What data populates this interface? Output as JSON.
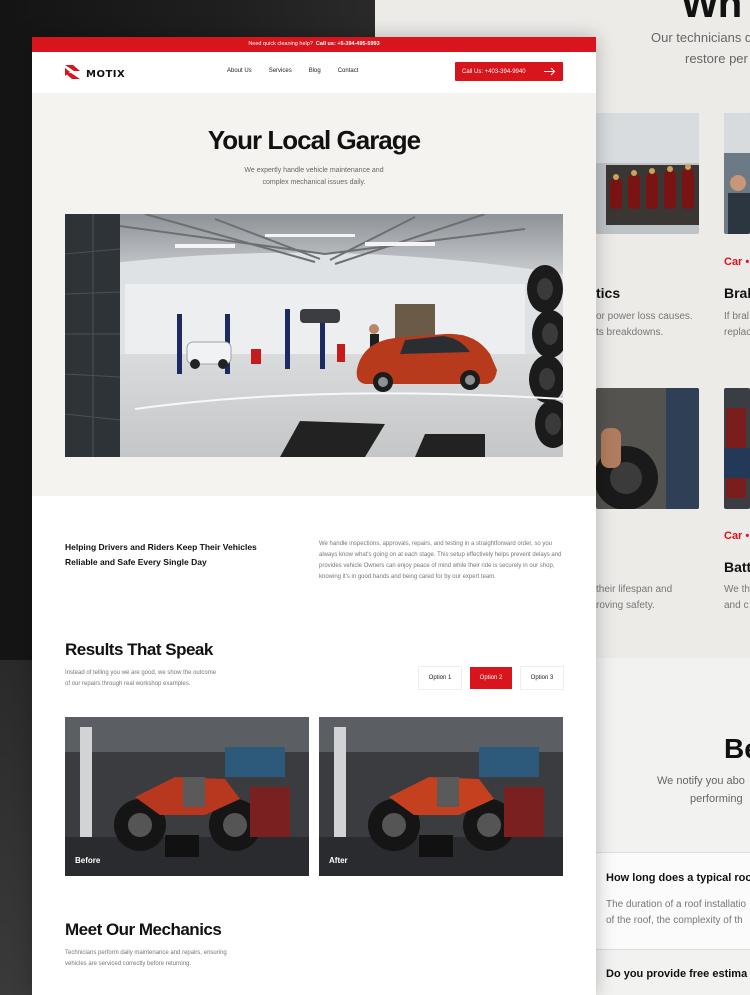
{
  "topbar": {
    "prompt": "Need quick cleaning help?",
    "phone": "Call us: +5-394-495-5993"
  },
  "nav": {
    "logo_text": "MOTIX",
    "links": [
      "About Us",
      "Services",
      "Blog",
      "Contact"
    ],
    "cta": "Call Us: +403-394-9940"
  },
  "hero": {
    "title": "Your Local Garage",
    "subtitle_line1": "We expertly handle vehicle maintenance and",
    "subtitle_line2": "complex mechanical issues daily."
  },
  "about": {
    "heading_line1": "Helping Drivers and Riders Keep Their Vehicles",
    "heading_line2": "Reliable and Safe Every Single Day",
    "body": "We handle inspections, approvals, repairs, and testing in a straightforward order, so you always know what's going on at each stage. This setup effectively helps prevent delays and provides vehicle Owners can enjoy peace of mind while their ride is securely in our shop, knowing it's in good hands and being cared for by our expert team."
  },
  "results": {
    "title": "Results That Speak",
    "body_line1": "Instead of telling you we are good, we show the outcome",
    "body_line2": "of our repairs through real workshop examples.",
    "options": [
      "Option 1",
      "Option 2",
      "Option 3"
    ],
    "active_option": "Option 2",
    "before_label": "Before",
    "after_label": "After"
  },
  "mechanics": {
    "title": "Meet Our Mechanics",
    "body_line1": "Technicians perform daily maintenance and repairs, ensuring",
    "body_line2": "vehicles are serviced correctly before returning."
  },
  "background_page": {
    "heading_fragment": "Wh",
    "intro_line1": "Our technicians d",
    "intro_line2": "restore per",
    "card1_text_title": "tics",
    "card1_text_line1": "or power loss causes.",
    "card1_text_line2": "ts breakdowns.",
    "card2_category": "Car •",
    "card2_title": "Bral",
    "card2_line1": "If bral",
    "card2_line2": "replac",
    "card3_line1": "their lifespan and",
    "card3_line2": "roving safety.",
    "card4_category": "Car •",
    "card4_title": "Batt",
    "card4_line1": "We th",
    "card4_line2": "and c",
    "section2_title": "Be",
    "section2_line1": "We notify you abo",
    "section2_line2": "performing",
    "faq1_question": "How long does a typical roo",
    "faq1_answer_line1": "The duration of a roof installatio",
    "faq1_answer_line2": "of the roof, the complexity of th",
    "faq2_question": "Do you provide free estima"
  },
  "colors": {
    "accent": "#d8141c",
    "hero_bg": "#f4f3ef",
    "text_dark": "#111111",
    "text_muted": "#777777"
  }
}
